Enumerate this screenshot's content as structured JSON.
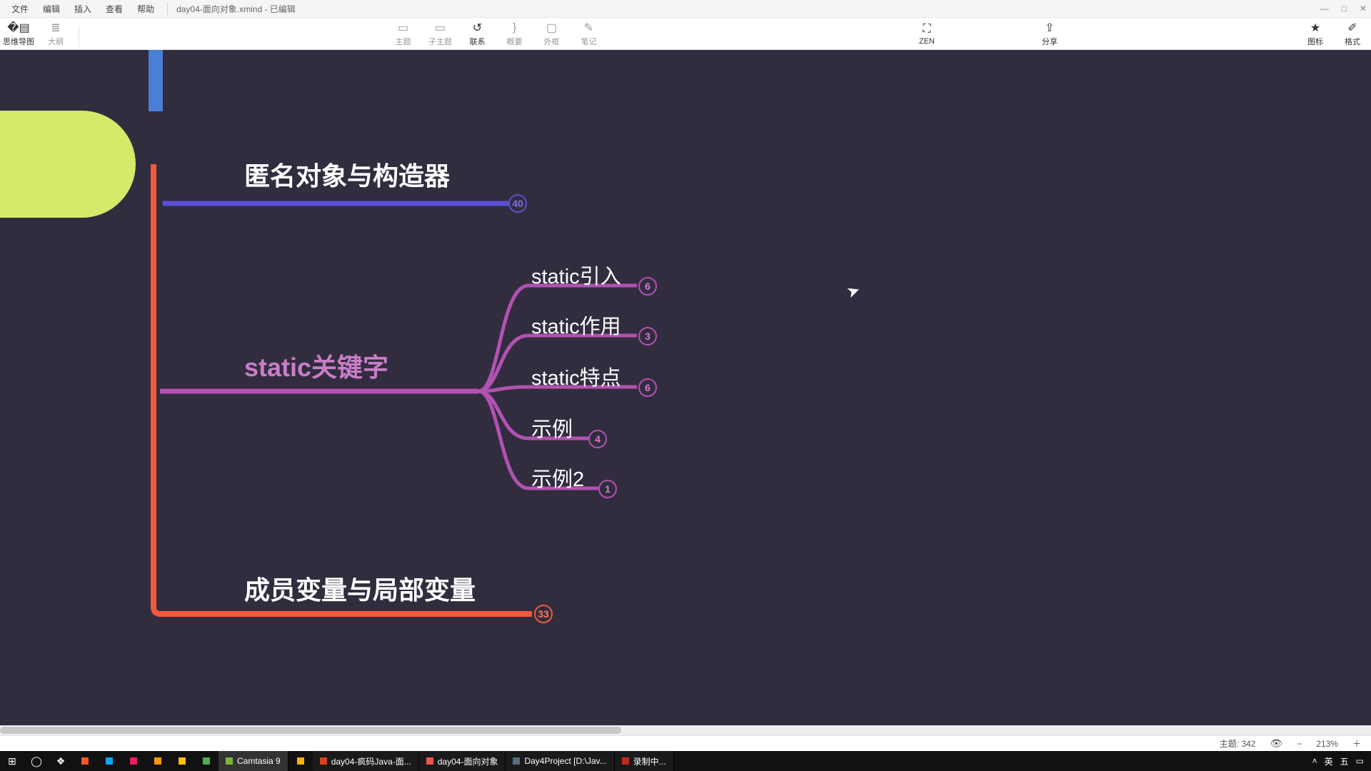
{
  "window": {
    "title_doc": "day04-面向对象.xmind - 已编辑",
    "min": "—",
    "max": "□",
    "close": "✕"
  },
  "menu": {
    "file": "文件",
    "edit": "编辑",
    "insert": "插入",
    "view": "查看",
    "help": "帮助"
  },
  "toolbar": {
    "mindmap": "思维导图",
    "outline": "大纲",
    "topic": "主题",
    "subtopic": "子主题",
    "relation": "联系",
    "summary": "概要",
    "boundary": "外框",
    "note": "笔记",
    "zen": "ZEN",
    "share": "分享",
    "iconlib": "图标",
    "format": "格式"
  },
  "mindmap": {
    "branch1": {
      "title": "匿名对象与构造器",
      "count": "40"
    },
    "branch2": {
      "title": "static关键字",
      "children": [
        {
          "label": "static引入",
          "count": "6"
        },
        {
          "label": "static作用",
          "count": "3"
        },
        {
          "label": "static特点",
          "count": "6"
        },
        {
          "label": "示例",
          "count": "4"
        },
        {
          "label": "示例2",
          "count": "1"
        }
      ]
    },
    "branch3": {
      "title": "成员变量与局部变量",
      "count": "33"
    }
  },
  "status": {
    "topics_label": "主题:",
    "topics_count": "342",
    "zoom": "213%"
  },
  "taskbar": {
    "items": [
      {
        "label": "Camtasia 9"
      },
      {
        "label": "day04-疯码Java-面..."
      },
      {
        "label": "day04-面向对象"
      },
      {
        "label": "Day4Project [D:\\Jav..."
      },
      {
        "label": "录制中..."
      }
    ],
    "tray": {
      "ime1": "英",
      "ime2": "五"
    }
  },
  "colors": {
    "canvas": "#322c3f",
    "branch1": "#5b4fd6",
    "branch2": "#b152b1",
    "branch3": "#f2593a",
    "root": "#d6e96b"
  }
}
